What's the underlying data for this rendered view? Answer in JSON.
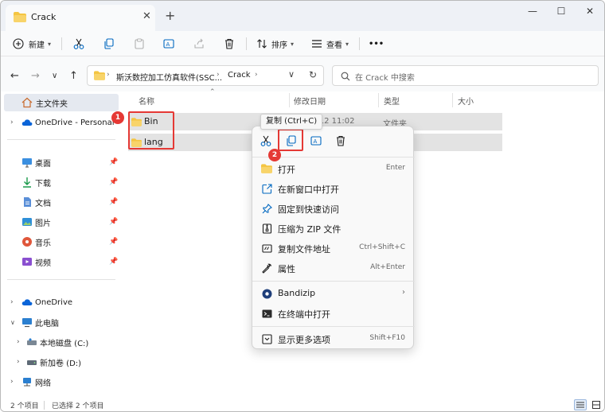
{
  "window": {
    "tab_title": "Crack",
    "new_tab": "+",
    "close_tab": "✕",
    "minimize": "—",
    "maximize": "☐",
    "close": "✕"
  },
  "toolbar": {
    "new_label": "新建",
    "sort_label": "排序",
    "view_label": "查看",
    "more_label": "•••"
  },
  "address": {
    "path_segment_1": "斯沃数控加工仿真软件(SSC...",
    "path_segment_2": "Crack",
    "sep": "›",
    "search_placeholder": "在 Crack 中搜索"
  },
  "sidebar": {
    "home": "主文件夹",
    "onedrive_personal": "OneDrive - Personal",
    "quick": [
      {
        "label": "桌面",
        "icon": "desktop-icon"
      },
      {
        "label": "下载",
        "icon": "download-icon"
      },
      {
        "label": "文档",
        "icon": "document-icon"
      },
      {
        "label": "图片",
        "icon": "picture-icon"
      },
      {
        "label": "音乐",
        "icon": "music-icon"
      },
      {
        "label": "视频",
        "icon": "video-icon"
      }
    ],
    "onedrive": "OneDrive",
    "this_pc": "此电脑",
    "drive_c": "本地磁盘 (C:)",
    "drive_d": "新加卷 (D:)",
    "network": "网络"
  },
  "columns": {
    "name": "名称",
    "modified": "修改日期",
    "type": "类型",
    "size": "大小"
  },
  "files": [
    {
      "name": "Bin",
      "date": "5/12 11:02",
      "type": "文件夹"
    },
    {
      "name": "lang",
      "date": "",
      "type": ""
    }
  ],
  "annotations": {
    "badge_1": "1",
    "badge_2": "2"
  },
  "tooltip": {
    "text": "复制 (Ctrl+C)"
  },
  "context_menu": {
    "items": [
      {
        "label": "打开",
        "shortcut": "Enter"
      },
      {
        "label": "在新窗口中打开",
        "shortcut": ""
      },
      {
        "label": "固定到快速访问",
        "shortcut": ""
      },
      {
        "label": "压缩为 ZIP 文件",
        "shortcut": ""
      },
      {
        "label": "复制文件地址",
        "shortcut": "Ctrl+Shift+C"
      },
      {
        "label": "属性",
        "shortcut": "Alt+Enter"
      },
      {
        "label": "Bandizip",
        "shortcut": "›"
      },
      {
        "label": "在终端中打开",
        "shortcut": ""
      },
      {
        "label": "显示更多选项",
        "shortcut": "Shift+F10"
      }
    ]
  },
  "status": {
    "count": "2 个项目",
    "selected": "已选择 2 个项目"
  },
  "colors": {
    "accent": "#0067c0",
    "folder": "#f4c542",
    "annotation_red": "#e53935"
  }
}
